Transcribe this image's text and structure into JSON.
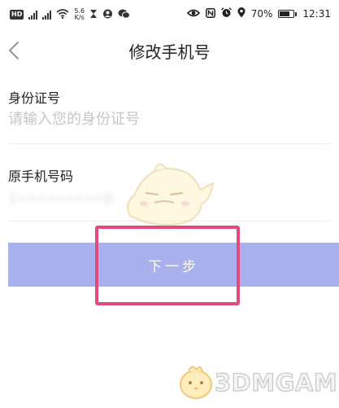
{
  "status_bar": {
    "hd1": "HD",
    "hd2": "HD",
    "net_speed_value": "5.6",
    "net_speed_unit": "K/s",
    "battery": "70%",
    "time": "12:31",
    "battery_level": 0.7,
    "icons": [
      "hd-icon",
      "signal-icon",
      "wifi-icon",
      "hourglass-icon",
      "chat-icon",
      "eye-icon",
      "nfc-icon",
      "alarm-icon",
      "location-icon",
      "battery-icon"
    ]
  },
  "header": {
    "title": "修改手机号",
    "back_icon": "chevron-left-icon"
  },
  "form": {
    "id_label": "身份证号",
    "id_placeholder": "请输入您的身份证号",
    "phone_label": "原手机号码",
    "phone_value": "1•••••••••9"
  },
  "next_button": {
    "label": "下一步"
  },
  "watermark": {
    "logo_text": "3DMGAME"
  },
  "colors": {
    "button": "#a8b0ee",
    "highlight": "#e14a7a"
  }
}
